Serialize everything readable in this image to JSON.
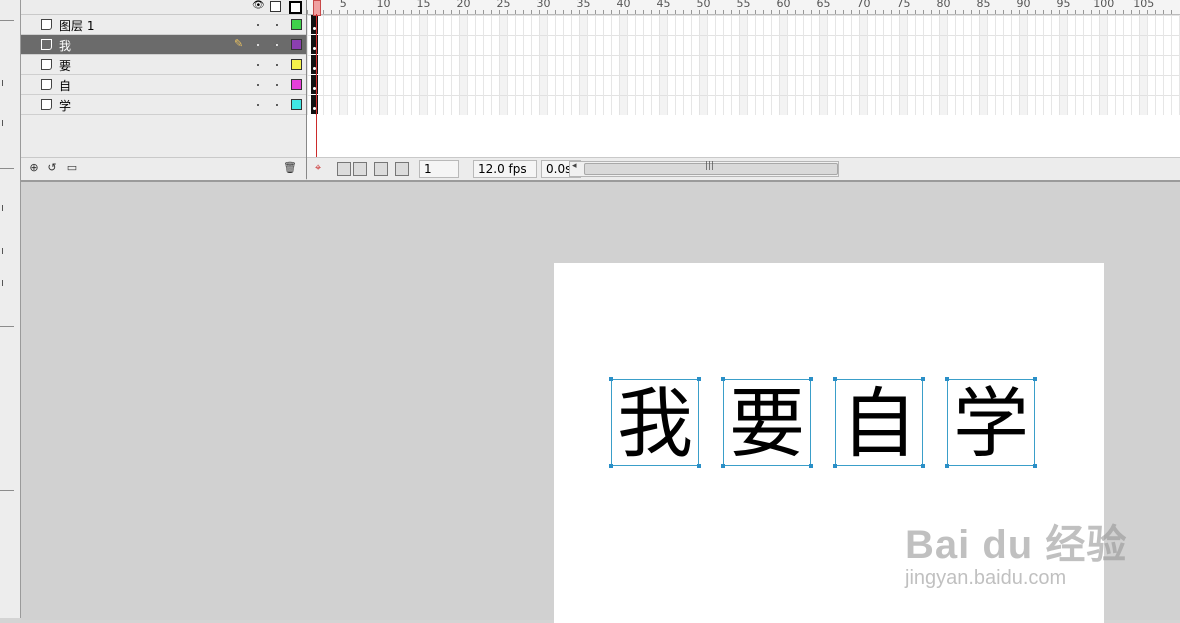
{
  "layers": [
    {
      "name": "图层 1",
      "color": "#3fd14a",
      "selected": false
    },
    {
      "name": "我",
      "color": "#8b3fb0",
      "selected": true
    },
    {
      "name": "要",
      "color": "#f4f24a",
      "selected": false
    },
    {
      "name": "自",
      "color": "#e63fd8",
      "selected": false
    },
    {
      "name": "学",
      "color": "#3fe7e4",
      "selected": false
    }
  ],
  "ruler_labels": [
    "5",
    "10",
    "15",
    "20",
    "25",
    "30",
    "35",
    "40",
    "45",
    "50",
    "55",
    "60",
    "65",
    "70",
    "75",
    "80",
    "85",
    "90",
    "95",
    "100",
    "105"
  ],
  "frame_toolbar": {
    "current_frame": "1",
    "fps": "12.0 fps",
    "time": "0.0s"
  },
  "stage": {
    "characters": [
      "我",
      "要",
      "自",
      "学"
    ]
  },
  "watermark": {
    "logo": "Bai du 经验",
    "url": "jingyan.baidu.com"
  },
  "icons": {
    "show_hide": "eye-icon",
    "lock": "lock-icon",
    "outline": "outline-icon",
    "layer": "layer-icon",
    "pencil": "pencil-icon",
    "trash": "trash-icon"
  }
}
